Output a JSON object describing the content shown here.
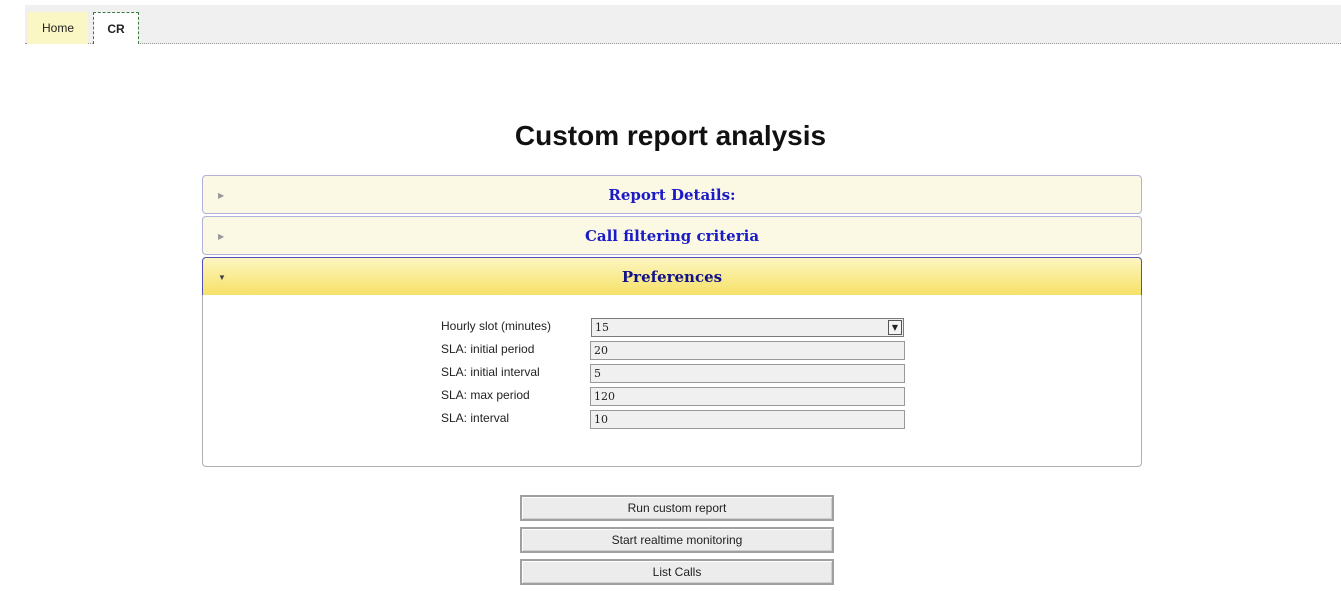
{
  "tabs": [
    {
      "label": "Home"
    },
    {
      "label": "CR"
    }
  ],
  "page": {
    "title": "Custom report analysis"
  },
  "accordion": {
    "sections": [
      {
        "label": "Report Details:"
      },
      {
        "label": "Call filtering criteria"
      },
      {
        "label": "Preferences"
      }
    ],
    "expanded": "Preferences"
  },
  "preferences": {
    "hourly_slot": {
      "label": "Hourly slot (minutes)",
      "value": "15"
    },
    "sla_initial_period": {
      "label": "SLA: initial period",
      "value": "20"
    },
    "sla_initial_interval": {
      "label": "SLA: initial interval",
      "value": "5"
    },
    "sla_max_period": {
      "label": "SLA: max period",
      "value": "120"
    },
    "sla_interval": {
      "label": "SLA: interval",
      "value": "10"
    }
  },
  "buttons": {
    "run": "Run custom report",
    "realtime": "Start realtime monitoring",
    "list": "List Calls"
  },
  "icons": {
    "collapsed": "triangle-right-icon",
    "expanded": "triangle-down-icon",
    "dropdown": "chevron-down-icon"
  },
  "colors": {
    "header_text": "#1a1ac8",
    "active_header": "#f6e167",
    "home_tab": "#fbf7c4"
  }
}
